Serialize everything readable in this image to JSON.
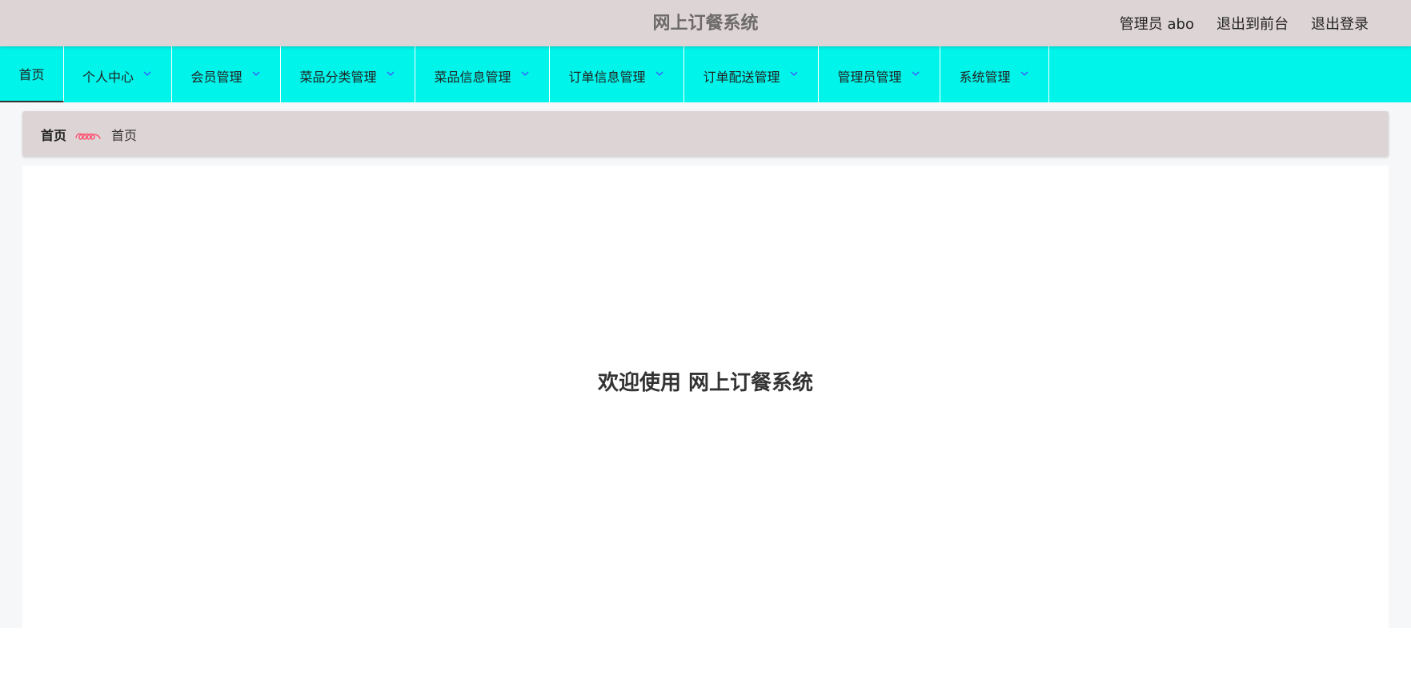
{
  "header": {
    "title": "网上订餐系统",
    "user_label": "管理员 abo",
    "front_label": "退出到前台",
    "logout_label": "退出登录"
  },
  "nav": {
    "items": [
      {
        "label": "首页"
      },
      {
        "label": "个人中心"
      },
      {
        "label": "会员管理"
      },
      {
        "label": "菜品分类管理"
      },
      {
        "label": "菜品信息管理"
      },
      {
        "label": "订单信息管理"
      },
      {
        "label": "订单配送管理"
      },
      {
        "label": "管理员管理"
      },
      {
        "label": "系统管理"
      }
    ],
    "active_index": 0
  },
  "breadcrumb": {
    "home": "首页",
    "current": "首页",
    "separator_icon": "triple-loop-icon"
  },
  "main": {
    "welcome": "欢迎使用 网上订餐系统"
  },
  "colors": {
    "header_bg": "#ddd4d5",
    "nav_bg": "#00f4ea",
    "chevron": "#3a55ff",
    "separator": "#ff4d6d",
    "content_bg": "#f6f7f9"
  }
}
